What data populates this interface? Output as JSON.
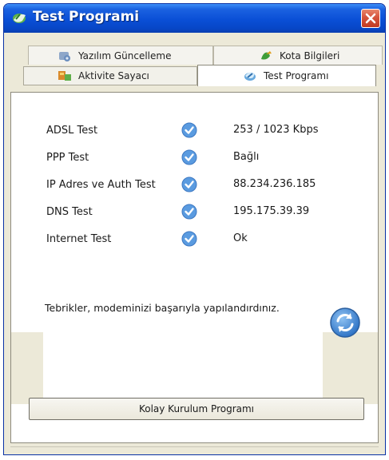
{
  "window": {
    "title": "Test Programi"
  },
  "tabs": [
    {
      "label": "Yazılım Güncelleme",
      "icon": "software-update-icon"
    },
    {
      "label": "Kota Bilgileri",
      "icon": "quota-info-icon"
    },
    {
      "label": "Aktivite Sayacı",
      "icon": "activity-counter-icon"
    },
    {
      "label": "Test Programı",
      "icon": "test-program-icon",
      "active": true
    }
  ],
  "tests": [
    {
      "name": "ADSL Test",
      "status": "ok",
      "value": "253 / 1023 Kbps"
    },
    {
      "name": "PPP Test",
      "status": "ok",
      "value": "Bağlı"
    },
    {
      "name": "IP Adres ve Auth Test",
      "status": "ok",
      "value": "88.234.236.185"
    },
    {
      "name": "DNS Test",
      "status": "ok",
      "value": "195.175.39.39"
    },
    {
      "name": "Internet Test",
      "status": "ok",
      "value": "Ok"
    }
  ],
  "message": "Tebrikler, modeminizi başarıyla yapılandırdınız.",
  "buttons": {
    "setup_program": "Kolay Kurulum Programı"
  },
  "colors": {
    "titlebar": "#0a4fd6",
    "check": "#5a9be0",
    "close": "#d5533b"
  }
}
